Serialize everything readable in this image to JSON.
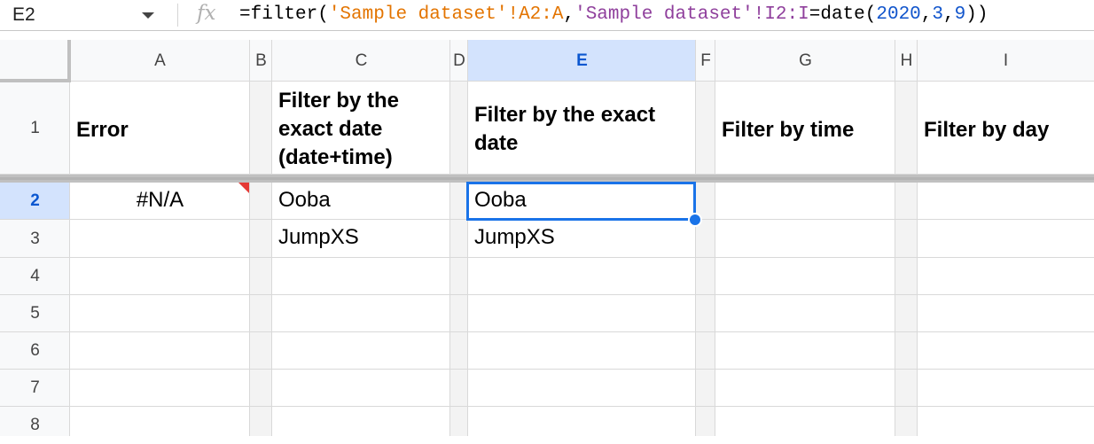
{
  "formula_bar": {
    "name_box": "E2",
    "fx_label": "fx",
    "formula_parts": [
      {
        "text": "=filter(",
        "color": "black"
      },
      {
        "text": "'Sample dataset'!A2:A",
        "color": "orange"
      },
      {
        "text": ",",
        "color": "black"
      },
      {
        "text": "'Sample dataset'!I2:I",
        "color": "purple"
      },
      {
        "text": "=date(",
        "color": "black"
      },
      {
        "text": "2020",
        "color": "blue"
      },
      {
        "text": ",",
        "color": "black"
      },
      {
        "text": "3",
        "color": "blue"
      },
      {
        "text": ",",
        "color": "black"
      },
      {
        "text": "9",
        "color": "blue"
      },
      {
        "text": "))",
        "color": "black"
      }
    ]
  },
  "columns": [
    "A",
    "B",
    "C",
    "D",
    "E",
    "F",
    "G",
    "H",
    "I"
  ],
  "rows": [
    "1",
    "2",
    "3",
    "4",
    "5",
    "6",
    "7",
    "8"
  ],
  "selected_cell": "E2",
  "cells": {
    "A1": "Error",
    "C1": "Filter by the\nexact date\n(date+time)",
    "E1": "Filter by the exact\ndate",
    "G1": "Filter by time",
    "I1": "Filter by day",
    "A2": "#N/A",
    "C2": "Ooba",
    "E2": "Ooba",
    "C3": "JumpXS",
    "E3": "JumpXS"
  },
  "colors": {
    "header_bg": "#f8f9fa",
    "selected_header_bg": "#d3e3fd",
    "gridline": "#e1e1e1",
    "narrow_col_bg": "#f3f3f3",
    "selection": "#1a73e8",
    "error_marker": "#e53935"
  }
}
